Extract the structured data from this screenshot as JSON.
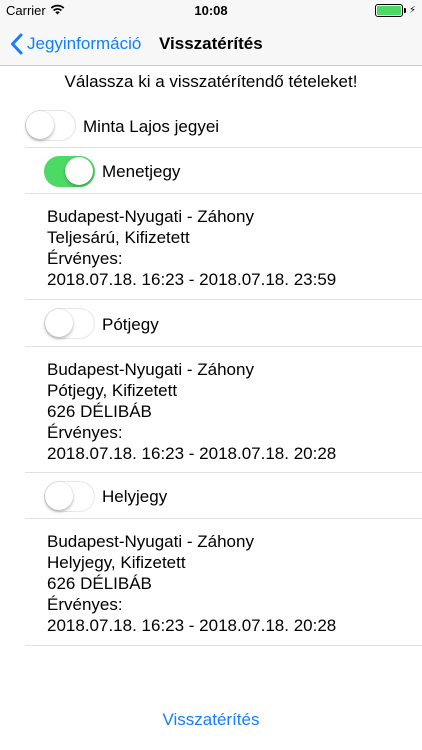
{
  "status_bar": {
    "carrier": "Carrier",
    "time": "10:08"
  },
  "nav": {
    "back_label": "Jegyinformáció",
    "title": "Visszatérítés"
  },
  "instruction": "Válassza ki a visszatérítendő tételeket!",
  "passenger": {
    "name": "Minta Lajos jegyei",
    "selected": false
  },
  "tickets": [
    {
      "type": "Menetjegy",
      "selected": true,
      "lines": [
        "Budapest-Nyugati - Záhony",
        "Teljesárú, Kifizetett",
        "Érvényes:",
        "2018.07.18. 16:23 - 2018.07.18. 23:59"
      ]
    },
    {
      "type": "Pótjegy",
      "selected": false,
      "lines": [
        "Budapest-Nyugati - Záhony",
        "Pótjegy, Kifizetett",
        "626 DÉLIBÁB",
        "Érvényes:",
        "2018.07.18. 16:23 - 2018.07.18. 20:28"
      ]
    },
    {
      "type": "Helyjegy",
      "selected": false,
      "lines": [
        "Budapest-Nyugati - Záhony",
        "Helyjegy, Kifizetett",
        "626 DÉLIBÁB",
        "Érvényes:",
        "2018.07.18. 16:23 - 2018.07.18. 20:28"
      ]
    }
  ],
  "refund_button": "Visszatérítés",
  "colors": {
    "accent": "#147efb",
    "toggle_on": "#4cd964",
    "separator": "#e0e0e0"
  }
}
